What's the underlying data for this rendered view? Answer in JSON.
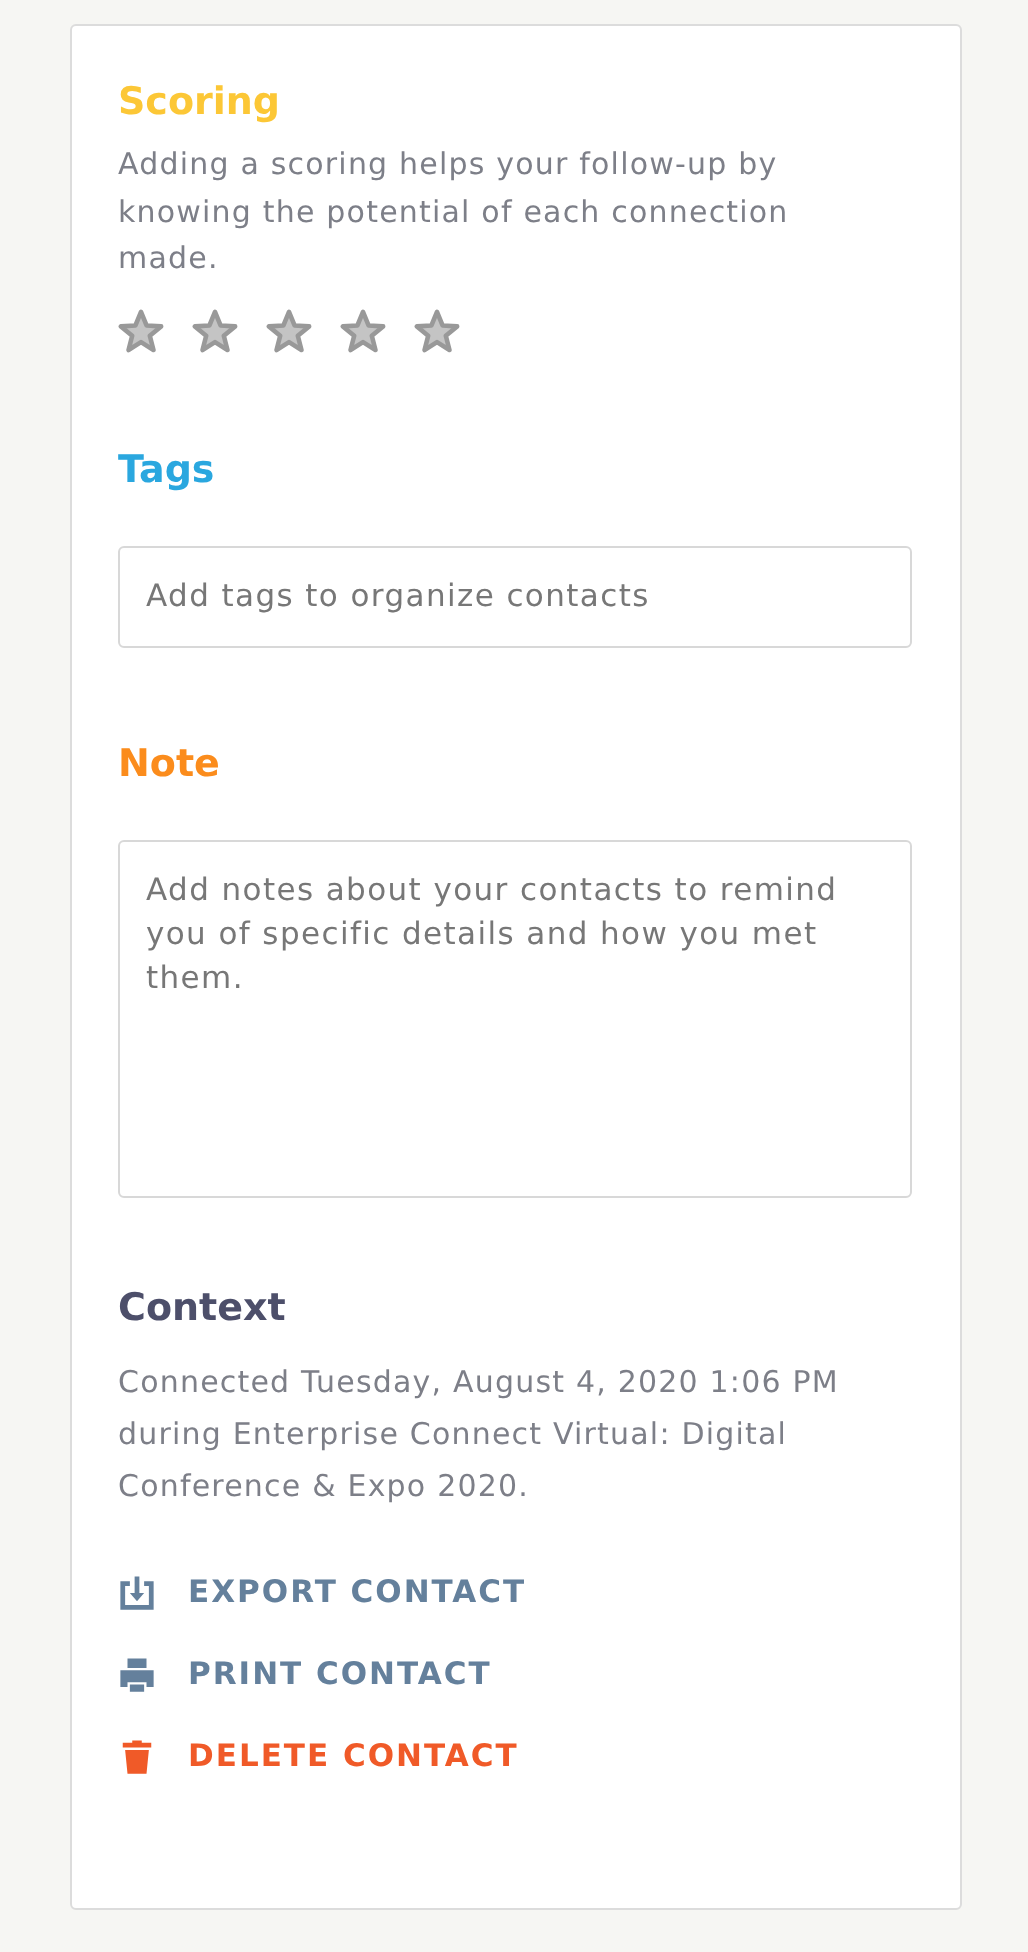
{
  "scoring": {
    "title": "Scoring",
    "description": "Adding a scoring helps your follow-up by knowing the potential of each connection made.",
    "stars": 0
  },
  "tags": {
    "title": "Tags",
    "placeholder": "Add tags to organize contacts"
  },
  "note": {
    "title": "Note",
    "placeholder": "Add notes about your contacts to remind you of specific details and how you met them."
  },
  "context": {
    "title": "Context",
    "text": "Connected Tuesday, August 4, 2020 1:06 PM during Enterprise Connect Virtual: Digital Conference & Expo 2020."
  },
  "actions": [
    {
      "kind": "export",
      "label": "EXPORT CONTACT"
    },
    {
      "kind": "print",
      "label": "PRINT CONTACT"
    },
    {
      "kind": "delete",
      "label": "DELETE CONTACT"
    }
  ]
}
